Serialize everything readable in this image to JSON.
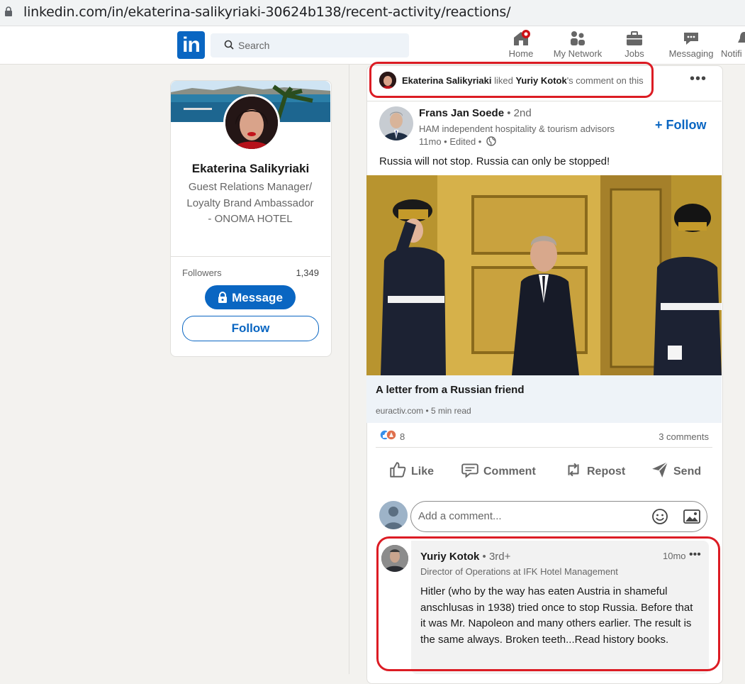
{
  "browser": {
    "url": "linkedin.com/in/ekaterina-salikyriaki-30624b138/recent-activity/reactions/"
  },
  "nav": {
    "logo": "in",
    "search_placeholder": "Search",
    "items": [
      {
        "label": "Home",
        "icon": "home-icon"
      },
      {
        "label": "My Network",
        "icon": "network-icon"
      },
      {
        "label": "Jobs",
        "icon": "briefcase-icon"
      },
      {
        "label": "Messaging",
        "icon": "messaging-icon"
      },
      {
        "label": "Notifi",
        "icon": "bell-icon"
      }
    ]
  },
  "profile": {
    "name": "Ekaterina Salikyriaki",
    "headline": "Guest Relations Manager/ Loyalty Brand Ambassador - ONOMA HOTEL",
    "followers_label": "Followers",
    "followers_count": "1,349",
    "message_label": "Message",
    "follow_label": "Follow"
  },
  "activity": {
    "actor": "Ekaterina Salikyriaki",
    "verb": " liked ",
    "target": "Yuriy Kotok",
    "suffix": "'s comment on this",
    "more": "•••"
  },
  "post": {
    "author": "Frans Jan Soede",
    "degree": " • 2nd",
    "headline": "HAM independent hospitality & tourism advisors",
    "time": "11mo • Edited •",
    "follow_label": "+ Follow",
    "text": "Russia will not stop. Russia can only be stopped!",
    "link_title": "A letter from a Russian friend",
    "link_source": "euractiv.com • 5 min read",
    "reaction_count": "8",
    "comments_count": "3 comments"
  },
  "actions": {
    "like": "Like",
    "comment": "Comment",
    "repost": "Repost",
    "send": "Send"
  },
  "comment_input": {
    "placeholder": "Add a comment..."
  },
  "comment": {
    "author": "Yuriy Kotok",
    "degree": " • 3rd+",
    "time": "10mo",
    "more": "•••",
    "headline": "Director of Operations at IFK Hotel Management",
    "text": "Hitler (who by the way has eaten Austria in shameful anschlusas in 1938) tried once to stop Russia. Before that it was Mr. Napoleon and many others earlier. The result is the same always. Broken teeth...Read history books."
  },
  "colors": {
    "brand": "#0a66c2",
    "highlight": "#dc1c24",
    "notification_badge": "#cc1016"
  }
}
